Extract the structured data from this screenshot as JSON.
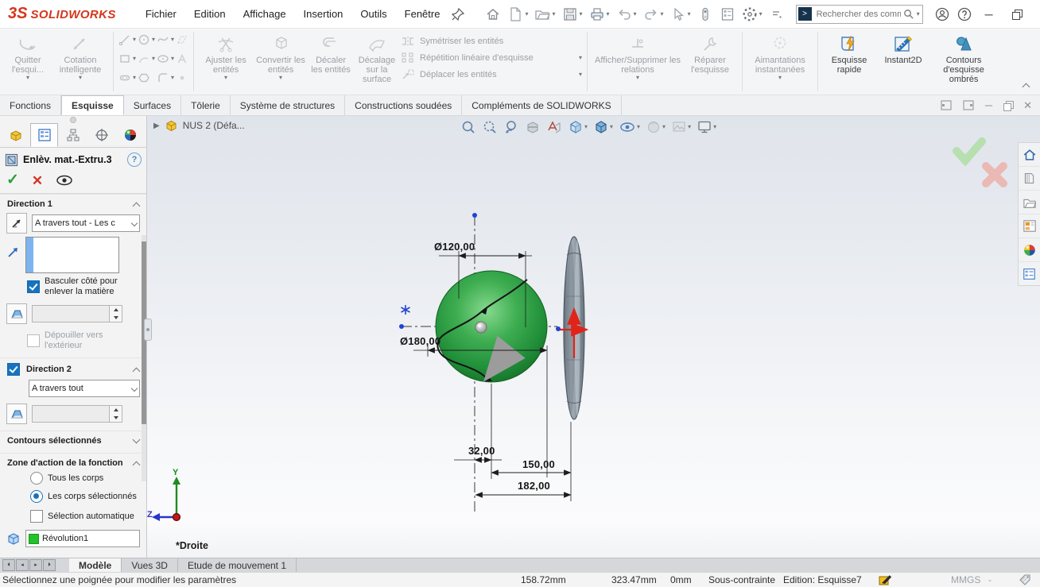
{
  "titlebar": {
    "brand_mark": "3S",
    "brand": "SOLIDWORKS",
    "menus": [
      "Fichier",
      "Edition",
      "Affichage",
      "Insertion",
      "Outils",
      "Fenêtre"
    ],
    "search_placeholder": "Rechercher des comm"
  },
  "ribbon": {
    "quitter": "Quitter l'esqui...",
    "cotation": "Cotation intelligente",
    "ajuster": "Ajuster les entités",
    "convertir": "Convertir les entités",
    "decaler": "Décaler les entités",
    "decalage": "Décalage sur la surface",
    "symetriser": "Symétriser les entités",
    "repetition": "Répétition linéaire d'esquisse",
    "deplacer": "Déplacer les entités",
    "afficher": "Afficher/Supprimer les relations",
    "reparer": "Réparer l'esquisse",
    "aimantations": "Aimantations instantanées",
    "esquisse_rapide": "Esquisse rapide",
    "instant2d": "Instant2D",
    "contours_ombres": "Contours d'esquisse ombrés"
  },
  "command_tabs": {
    "items": [
      "Fonctions",
      "Esquisse",
      "Surfaces",
      "Tôlerie",
      "Système de structures",
      "Constructions soudées",
      "Compléments de SOLIDWORKS"
    ],
    "active": "Esquisse"
  },
  "property_manager": {
    "title": "Enlèv. mat.-Extru.3",
    "direction1": {
      "header": "Direction 1",
      "end_condition": "A travers tout - Les c",
      "flip_side": "Basculer côté pour enlever la matière",
      "draft_outward": "Dépouiller vers l'extérieur"
    },
    "direction2": {
      "header": "Direction 2",
      "end_condition": "A travers tout"
    },
    "selected_contours_header": "Contours sélectionnés",
    "feature_scope": {
      "header": "Zone d'action de la fonction",
      "all_bodies": "Tous les corps",
      "selected_bodies": "Les corps sélectionnés",
      "auto_select": "Sélection automatique",
      "body_item": "Révolution1"
    }
  },
  "viewport": {
    "document": "NUS 2  (Défa...",
    "view_name": "*Droite",
    "dimensions": {
      "dia_small": "Ø120,00",
      "dia_large": "Ø180,00",
      "offset": "32,00",
      "length": "150,00",
      "total": "182,00"
    },
    "triad": {
      "y": "Y",
      "z": "Z"
    }
  },
  "bottom_bar": {
    "tabs": [
      "Modèle",
      "Vues 3D",
      "Etude de mouvement 1"
    ],
    "active": "Modèle"
  },
  "status_bar": {
    "message": "Sélectionnez une poignée pour modifier les paramètres",
    "x": "158.72mm",
    "y": "323.47mm",
    "z": "0mm",
    "state": "Sous-contrainte",
    "edition": "Edition: Esquisse7",
    "units": "MMGS",
    "units_sep": "-"
  },
  "colors": {
    "accent_blue": "#1673c0",
    "part_green": "#2f9e43",
    "brand_red": "#d6361c",
    "disabled_gray": "#9aa1a8"
  }
}
